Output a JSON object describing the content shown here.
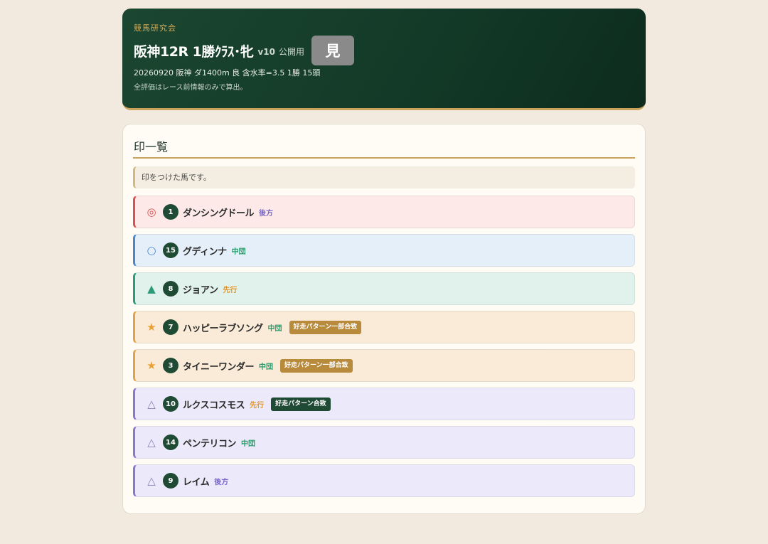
{
  "header": {
    "club": "競馬研究会",
    "race_title": "阪神12R 1勝ｸﾗｽ･牝",
    "version": "v10",
    "visibility": "公開用",
    "view_button": "見",
    "meta": "20260920 阪神 ダ1400m 良 含水率=3.5 1勝 15頭",
    "note": "全評価はレース前情報のみで算出。"
  },
  "section": {
    "title": "印一覧",
    "info": "印をつけた馬です。"
  },
  "colors": {
    "accent_gold": "#c9a35c",
    "header_green": "#133a28",
    "number_badge": "#1f4a34",
    "double_circle_row": "#fce9e8",
    "circle_row": "#e5effa",
    "triangle_filled_row": "#e1f2ec",
    "star_row": "#faebd9",
    "triangle_open_row": "#eceafa",
    "badge_partial": "#b88a3c",
    "badge_full": "#1f4a34"
  },
  "rows": [
    {
      "mark": "◎",
      "icon": "double-circle-icon",
      "number": "1",
      "name": "ダンシングドール",
      "style": "後方",
      "badge": ""
    },
    {
      "mark": "○",
      "icon": "circle-icon",
      "number": "15",
      "name": "グディンナ",
      "style": "中団",
      "badge": ""
    },
    {
      "mark": "▲",
      "icon": "filled-triangle-icon",
      "number": "8",
      "name": "ジョアン",
      "style": "先行",
      "badge": ""
    },
    {
      "mark": "★",
      "icon": "star-icon",
      "number": "7",
      "name": "ハッピーラブソング",
      "style": "中団",
      "badge": "好走パターン一部合致"
    },
    {
      "mark": "★",
      "icon": "star-icon",
      "number": "3",
      "name": "タイニーワンダー",
      "style": "中団",
      "badge": "好走パターン一部合致"
    },
    {
      "mark": "△",
      "icon": "open-triangle-icon",
      "number": "10",
      "name": "ルクスコスモス",
      "style": "先行",
      "badge": "好走パターン合致"
    },
    {
      "mark": "△",
      "icon": "open-triangle-icon",
      "number": "14",
      "name": "ペンテリコン",
      "style": "中団",
      "badge": ""
    },
    {
      "mark": "△",
      "icon": "open-triangle-icon",
      "number": "9",
      "name": "レイム",
      "style": "後方",
      "badge": ""
    }
  ]
}
